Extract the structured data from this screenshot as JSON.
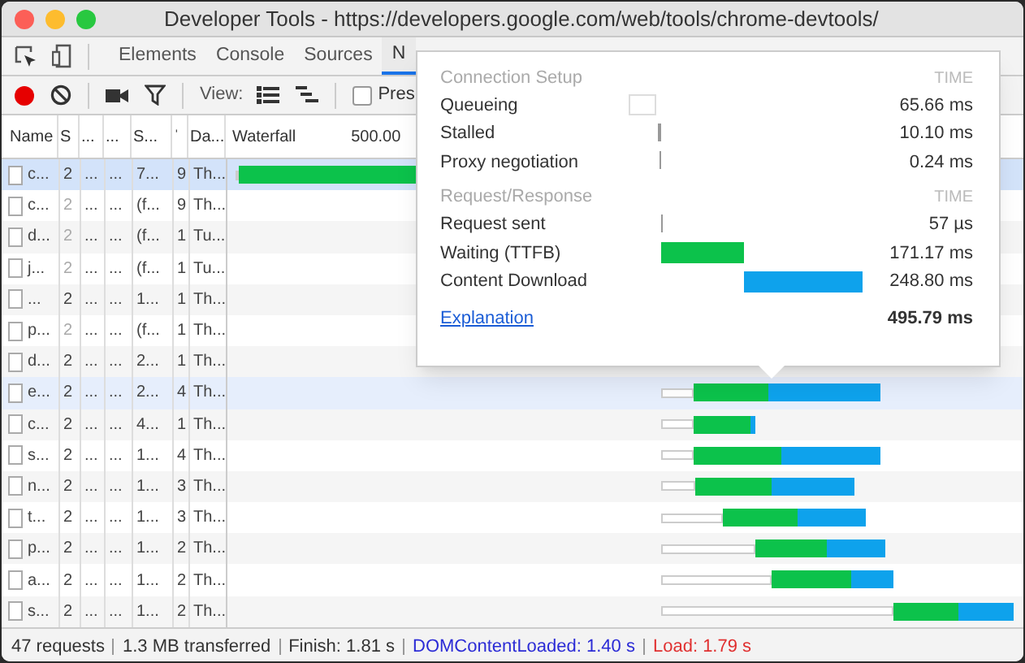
{
  "window": {
    "title": "Developer Tools - https://developers.google.com/web/tools/chrome-devtools/"
  },
  "tabs": [
    {
      "label": "Elements",
      "selected": false
    },
    {
      "label": "Console",
      "selected": false
    },
    {
      "label": "Sources",
      "selected": false
    },
    {
      "label": "N",
      "selected": true
    }
  ],
  "toolbar": {
    "view_label": "View:",
    "preserve_log": {
      "label": "Pres",
      "checked": false
    },
    "recording": true
  },
  "table": {
    "columns": [
      "Name",
      "S",
      "...",
      "...",
      "S...",
      "ˈ",
      "Da...",
      "Waterfall",
      "500.00"
    ],
    "rows": [
      {
        "cells": [
          "c...",
          "2",
          "...",
          "...",
          "7...",
          "9",
          "Th..."
        ],
        "selected": true,
        "hovered": false,
        "dimmed": false
      },
      {
        "cells": [
          "c...",
          "2",
          "...",
          "...",
          "(f...",
          "9",
          "Th..."
        ],
        "selected": false,
        "hovered": false,
        "dimmed": true
      },
      {
        "cells": [
          "d...",
          "2",
          "...",
          "...",
          "(f...",
          "1",
          "Tu..."
        ],
        "selected": false,
        "hovered": false,
        "dimmed": true
      },
      {
        "cells": [
          "j...",
          "2",
          "...",
          "...",
          "(f...",
          "1",
          "Tu..."
        ],
        "selected": false,
        "hovered": false,
        "dimmed": true
      },
      {
        "cells": [
          "...",
          "2",
          "...",
          "...",
          "1...",
          "1",
          "Th..."
        ],
        "selected": false,
        "hovered": false,
        "dimmed": false
      },
      {
        "cells": [
          "p...",
          "2",
          "...",
          "...",
          "(f...",
          "1",
          "Th..."
        ],
        "selected": false,
        "hovered": false,
        "dimmed": true
      },
      {
        "cells": [
          "d...",
          "2",
          "...",
          "...",
          "2...",
          "1",
          "Th..."
        ],
        "selected": false,
        "hovered": false,
        "dimmed": false
      },
      {
        "cells": [
          "e...",
          "2",
          "...",
          "...",
          "2...",
          "4",
          "Th..."
        ],
        "selected": false,
        "hovered": true,
        "dimmed": false
      },
      {
        "cells": [
          "c...",
          "2",
          "...",
          "...",
          "4...",
          "1",
          "Th..."
        ],
        "selected": false,
        "hovered": false,
        "dimmed": false
      },
      {
        "cells": [
          "s...",
          "2",
          "...",
          "...",
          "1...",
          "4",
          "Th..."
        ],
        "selected": false,
        "hovered": false,
        "dimmed": false
      },
      {
        "cells": [
          "n...",
          "2",
          "...",
          "...",
          "1...",
          "3",
          "Th..."
        ],
        "selected": false,
        "hovered": false,
        "dimmed": false
      },
      {
        "cells": [
          "t...",
          "2",
          "...",
          "...",
          "1...",
          "3",
          "Th..."
        ],
        "selected": false,
        "hovered": false,
        "dimmed": false
      },
      {
        "cells": [
          "p...",
          "2",
          "...",
          "...",
          "1...",
          "2",
          "Th..."
        ],
        "selected": false,
        "hovered": false,
        "dimmed": false
      },
      {
        "cells": [
          "a...",
          "2",
          "...",
          "...",
          "1...",
          "2",
          "Th..."
        ],
        "selected": false,
        "hovered": false,
        "dimmed": false
      },
      {
        "cells": [
          "s...",
          "2",
          "...",
          "...",
          "1...",
          "2",
          "Th..."
        ],
        "selected": false,
        "hovered": false,
        "dimmed": false
      }
    ]
  },
  "timing_popover": {
    "sections": [
      {
        "title": "Connection Setup",
        "time_heading": "TIME",
        "items": [
          {
            "label": "Queueing",
            "value": "65.66 ms"
          },
          {
            "label": "Stalled",
            "value": "10.10 ms"
          },
          {
            "label": "Proxy negotiation",
            "value": "0.24 ms"
          }
        ]
      },
      {
        "title": "Request/Response",
        "time_heading": "TIME",
        "items": [
          {
            "label": "Request sent",
            "value": "57 µs"
          },
          {
            "label": "Waiting (TTFB)",
            "value": "171.17 ms"
          },
          {
            "label": "Content Download",
            "value": "248.80 ms"
          }
        ]
      }
    ],
    "explanation_link": "Explanation",
    "total": "495.79 ms"
  },
  "status_bar": [
    {
      "text": "47 requests",
      "kind": "plain"
    },
    {
      "text": "1.3 MB transferred",
      "kind": "plain"
    },
    {
      "text": "Finish: 1.81 s",
      "kind": "plain"
    },
    {
      "text": "DOMContentLoaded: 1.40 s",
      "kind": "dom"
    },
    {
      "text": "Load: 1.79 s",
      "kind": "load"
    }
  ]
}
